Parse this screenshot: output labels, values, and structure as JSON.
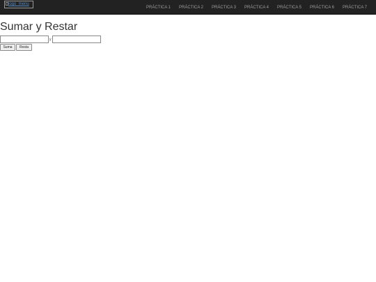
{
  "navbar": {
    "logo_alt": "logo_menu",
    "items": [
      {
        "label": "PRÁCTICA 1"
      },
      {
        "label": "PRÁCTICA 2"
      },
      {
        "label": "PRÁCTICA 3"
      },
      {
        "label": "PRÁCTICA 4"
      },
      {
        "label": "PRÁCTICA 5"
      },
      {
        "label": "PRÁCTICA 6"
      },
      {
        "label": "PRÁCTICA 7"
      }
    ]
  },
  "main": {
    "title": "Sumar y Restar",
    "first_value": "",
    "joiner": "y",
    "second_value": "",
    "add_label": "Suma",
    "subtract_label": "Resta"
  },
  "colors": {
    "navbar_bg": "#222222",
    "nav_text": "#9d9d9d",
    "link_blue": "#5b8fc7"
  }
}
